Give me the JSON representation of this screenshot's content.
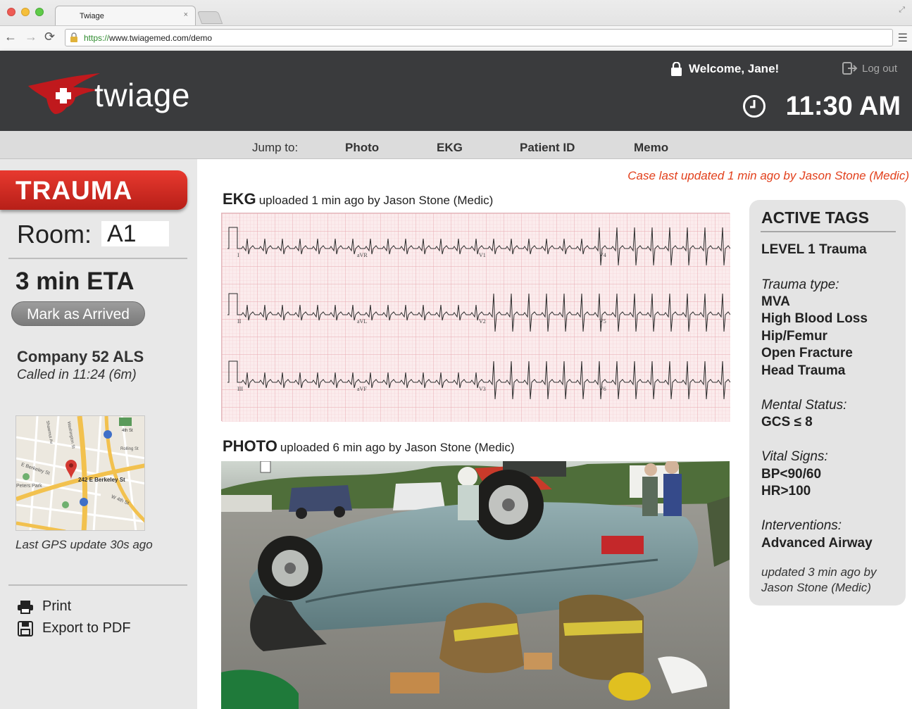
{
  "browser": {
    "tab_title": "Twiage",
    "tab_close": "×",
    "url_scheme": "https://",
    "url_rest": "www.twiagemed.com/demo"
  },
  "header": {
    "logo_text": "twiage",
    "welcome": "Welcome, Jane!",
    "logout": "Log out",
    "time": "11:30 AM"
  },
  "jump": {
    "label": "Jump to:",
    "links": [
      "Photo",
      "EKG",
      "Patient ID",
      "Memo"
    ]
  },
  "sidebar": {
    "banner": "TRAUMA",
    "room_label": "Room:",
    "room_value": "A1",
    "eta": "3 min ETA",
    "arrived_button": "Mark as Arrived",
    "company": "Company 52 ALS",
    "called_in": "Called in 11:24 (6m)",
    "map_address": "242 E Berkeley St",
    "map_labels": [
      "E Berkeley St",
      "W 4th St",
      "Peters Park",
      "Shawmut Av",
      "Washington St",
      "Rolling St",
      "4th St"
    ],
    "gps": "Last GPS update 30s ago",
    "print": "Print",
    "export": "Export to PDF"
  },
  "main": {
    "case_updated": "Case last updated 1 min ago by Jason Stone (Medic)",
    "ekg_title": "EKG",
    "ekg_sub": "uploaded 1 min ago by Jason Stone (Medic)",
    "ekg_leads": [
      "I",
      "aVR",
      "V1",
      "V4",
      "II",
      "aVL",
      "V2",
      "V5",
      "III",
      "aVF",
      "V3",
      "V6"
    ],
    "photo_title": "PHOTO",
    "photo_sub": "uploaded 6 min ago by Jason Stone (Medic)"
  },
  "tags": {
    "title": "ACTIVE TAGS",
    "level": "LEVEL 1 Trauma",
    "trauma_type_label": "Trauma type:",
    "trauma_types": [
      "MVA",
      "High Blood Loss",
      "Hip/Femur",
      "Open Fracture",
      "Head Trauma"
    ],
    "mental_label": "Mental Status:",
    "mental_value": "GCS ≤ 8",
    "vitals_label": "Vital Signs:",
    "vitals": [
      "BP<90/60",
      "HR>100"
    ],
    "interventions_label": "Interventions:",
    "intervention": "Advanced Airway",
    "updated_line1": "updated 3 min ago by",
    "updated_line2": "Jason Stone (Medic)"
  },
  "colors": {
    "header_bg": "#3a3b3d",
    "trauma_red": "#d12a22",
    "case_updated_orange": "#e2401c",
    "ekg_grid": "#f0c4c8"
  }
}
